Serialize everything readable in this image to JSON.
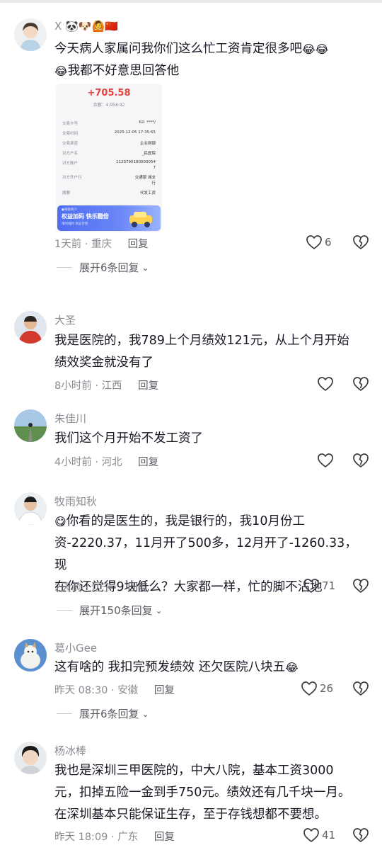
{
  "comments": [
    {
      "username": "X",
      "user_badges": [
        "🐼",
        "🐶",
        "🙆",
        "🇨🇳"
      ],
      "text_line1": "今天病人家属问我你们这么忙工资肯定很多吧",
      "text_line2": "我都不好意思回答他",
      "emoji": "😂",
      "time": "1天前",
      "location": "重庆",
      "reply_label": "回复",
      "likes": "6",
      "expand_label": "展开6条回复",
      "receipt": {
        "amount": "+705.58",
        "balance": "余额：4,958.92",
        "rows": [
          {
            "label": "交易卡号",
            "value": "62:          ****/"
          },
          {
            "label": "交易时间",
            "value": "2025-12-05 17:35:55"
          },
          {
            "label": "交易渠道",
            "value": "企业网银"
          },
          {
            "label": "对方户名",
            "value": "_民医院"
          },
          {
            "label": "对方账户",
            "value": "1120790180000054"
          },
          {
            "label": "",
            "value": "7"
          },
          {
            "label": "对方开户行",
            "value": "交通银 城支"
          },
          {
            "label": "",
            "value": "行"
          },
          {
            "label": "摘要",
            "value": "代发工资"
          }
        ],
        "ad_top": "●银联商户",
        "ad_main": "权益加码 快乐翻倍",
        "ad_sub": "限时福利 领支付券"
      }
    },
    {
      "username": "大圣",
      "text_line1": "我是医院的，我789上个月绩效121元，从上个月开始",
      "text_line2": "绩效奖金就没有了",
      "time": "8小时前",
      "location": "江西",
      "reply_label": "回复"
    },
    {
      "username": "朱佳川",
      "text_line1": "我们这个月开始不发工资了",
      "time": "4小时前",
      "location": "河北",
      "reply_label": "回复"
    },
    {
      "username": "牧雨知秋",
      "emoji": "😋",
      "text_line1": "你看的是医生的，我是银行的，我10月份工",
      "text_line2": "资-2220.37，11月开了500多，12月开了-1260.33，现",
      "text_line3": "在你还觉得9块低么？大家都一样，忙的脚不沾地",
      "time": "2天前",
      "location": "辽宁",
      "reply_label": "回复",
      "likes": "71",
      "expand_label": "展开150条回复"
    },
    {
      "username": "葛小Gee",
      "text_line1": "这有啥的 我扣完预发绩效 还欠医院八块五",
      "emoji": "😂",
      "time": "昨天 08:30",
      "location": "安徽",
      "reply_label": "回复",
      "likes": "26",
      "expand_label": "展开6条回复"
    },
    {
      "username": "杨冰棒",
      "text_line1": "我也是深圳三甲医院的，中大八院，基本工资3000",
      "text_line2": "元，扣掉五险一金到手750元。绩效还有几千块一月。",
      "text_line3": "在深圳基本只能保证生存，至于存钱想都不要想。",
      "time": "昨天 18:09",
      "location": "广东",
      "reply_label": "回复",
      "likes": "41"
    }
  ],
  "icons": {
    "like": "heart-outline-icon",
    "dislike": "broken-heart-icon",
    "expand": "chevron-down-icon"
  },
  "colors": {
    "text": "#161823",
    "meta": "#8a8b91",
    "accent_amount": "#e2453c"
  },
  "separator": "·",
  "chevron": "⌄"
}
